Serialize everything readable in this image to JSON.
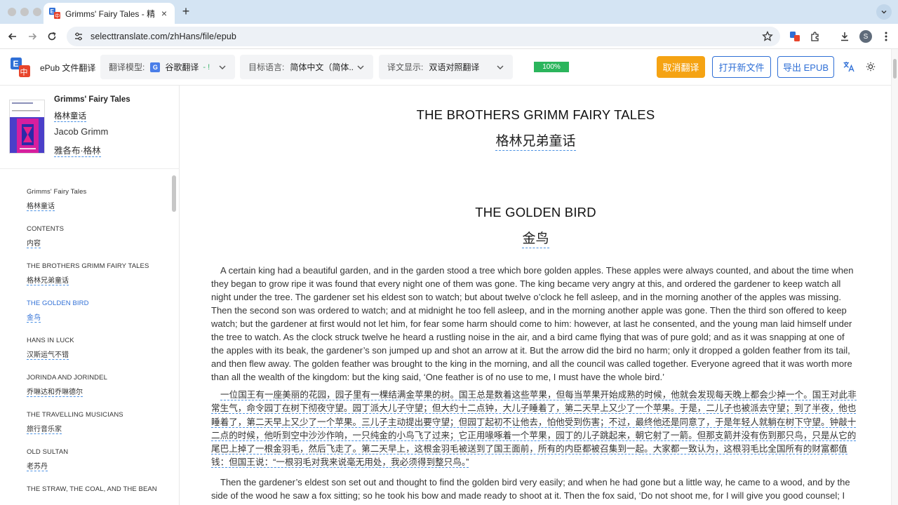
{
  "browser": {
    "tab_title": "Grimms' Fairy Tales - 精挑翻译",
    "url": "selecttranslate.com/zhHans/file/epub",
    "profile_initial": "S"
  },
  "app": {
    "title": "ePub 文件翻译",
    "model_label": "翻译模型:",
    "model_value": "谷歌翻译",
    "target_label": "目标语言:",
    "target_value": "简体中文（简体...",
    "display_label": "译文显示:",
    "display_value": "双语对照翻译",
    "progress": "100%",
    "cancel_btn": "取消翻译",
    "open_btn": "打开新文件",
    "export_btn": "导出 EPUB"
  },
  "book": {
    "title": "Grimms' Fairy Tales",
    "title_tr": "格林童话",
    "author": "Jacob Grimm",
    "author_tr": "雅各布·格林"
  },
  "toc": [
    {
      "en": "Grimms' Fairy Tales",
      "zh": "格林童话"
    },
    {
      "en": "CONTENTS",
      "zh": "内容"
    },
    {
      "en": "THE BROTHERS GRIMM FAIRY TALES",
      "zh": "格林兄弟童话"
    },
    {
      "en": "THE GOLDEN BIRD",
      "zh": "金鸟"
    },
    {
      "en": "HANS IN LUCK",
      "zh": "汉斯运气不错"
    },
    {
      "en": "JORINDA AND JORINDEL",
      "zh": "乔琳达和乔琳德尔"
    },
    {
      "en": "THE TRAVELLING MUSICIANS",
      "zh": "旅行音乐家"
    },
    {
      "en": "OLD SULTAN",
      "zh": "老苏丹"
    },
    {
      "en": "THE STRAW, THE COAL, AND THE BEAN",
      "zh": ""
    }
  ],
  "reader": {
    "heading1_en": "THE BROTHERS GRIMM FAIRY TALES",
    "heading1_zh": "格林兄弟童话",
    "heading2_en": "THE GOLDEN BIRD",
    "heading2_zh": "金鸟",
    "para1_en": "A certain king had a beautiful garden, and in the garden stood a tree which bore golden apples. These apples were always counted, and about the time when they began to grow ripe it was found that every night one of them was gone. The king became very angry at this, and ordered the gardener to keep watch all night under the tree. The gardener set his eldest son to watch; but about twelve o’clock he fell asleep, and in the morning another of the apples was missing. Then the second son was ordered to watch; and at midnight he too fell asleep, and in the morning another apple was gone. Then the third son offered to keep watch; but the gardener at first would not let him, for fear some harm should come to him: however, at last he consented, and the young man laid himself under the tree to watch. As the clock struck twelve he heard a rustling noise in the air, and a bird came flying that was of pure gold; and as it was snapping at one of the apples with its beak, the gardener’s son jumped up and shot an arrow at it. But the arrow did the bird no harm; only it dropped a golden feather from its tail, and then flew away. The golden feather was brought to the king in the morning, and all the council was called together. Everyone agreed that it was worth more than all the wealth of the kingdom: but the king said, ‘One feather is of no use to me, I must have the whole bird.’",
    "para1_zh": "一位国王有一座美丽的花园，园子里有一棵结满金苹果的树。国王总是数着这些苹果，但每当苹果开始成熟的时候，他就会发现每天晚上都会少掉一个。国王对此非常生气，命令园丁在树下彻夜守望。园丁派大儿子守望；但大约十二点钟，大儿子睡着了，第二天早上又少了一个苹果。于是，二儿子也被派去守望；到了半夜，他也睡着了，第二天早上又少了一个苹果。三儿子主动提出要守望；但园丁起初不让他去，怕他受到伤害；不过，最终他还是同意了，于是年轻人就躺在树下守望。钟敲十二点的时候，他听到空中沙沙作响，一只纯金的小鸟飞了过来；它正用喙啄着一个苹果，园丁的儿子跳起来，朝它射了一箭。但那支箭并没有伤到那只鸟，只是从它的尾巴上掉了一根金羽毛，然后飞走了。第二天早上，这根金羽毛被送到了国王面前，所有的内臣都被召集到一起。大家都一致认为，这根羽毛比全国所有的财富都值钱：但国王说：“一根羽毛对我来说毫无用处，我必须得到整只鸟。”",
    "para2_en": "Then the gardener’s eldest son set out and thought to find the golden bird very easily; and when he had gone but a little way, he came to a wood, and by the side of the wood he saw a fox sitting; so he took his bow and made ready to shoot at it. Then the fox said, ‘Do not shoot me, for I will give you good counsel; I"
  }
}
